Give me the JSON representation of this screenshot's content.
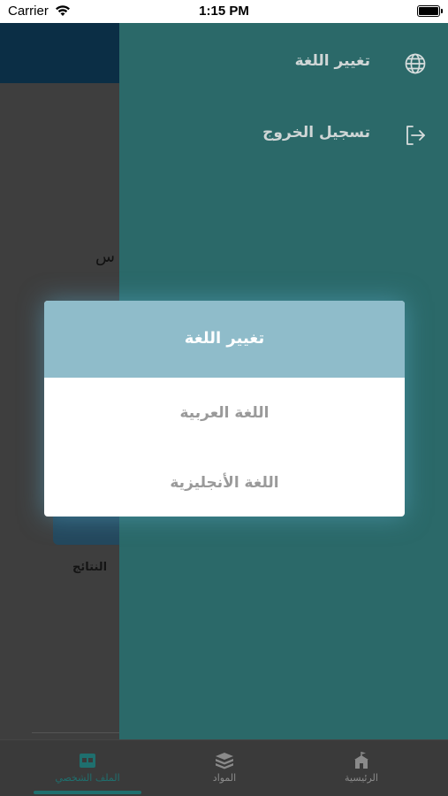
{
  "status_bar": {
    "carrier": "Carrier",
    "time": "1:15 PM"
  },
  "background": {
    "partial_text": "س",
    "results_label": "النتائج"
  },
  "drawer": {
    "items": [
      {
        "label": "تغيير اللغة",
        "icon": "globe-icon"
      },
      {
        "label": "تسجيل الخروج",
        "icon": "logout-icon"
      }
    ]
  },
  "dialog": {
    "title": "تغيير اللغة",
    "options": [
      {
        "label": "اللغة العربية"
      },
      {
        "label": "اللغة الأنجليزية"
      }
    ]
  },
  "tabbar": {
    "tabs": [
      {
        "label": "الملف الشخصي",
        "icon": "profile-card-icon",
        "active": true
      },
      {
        "label": "المواد",
        "icon": "books-icon",
        "active": false
      },
      {
        "label": "الرئيسية",
        "icon": "home-icon",
        "active": false
      }
    ]
  },
  "colors": {
    "drawer": "#2b6969",
    "dialog_header": "#8fbcca",
    "accent": "#1f6f6e",
    "header_dark": "#0b2e45"
  }
}
